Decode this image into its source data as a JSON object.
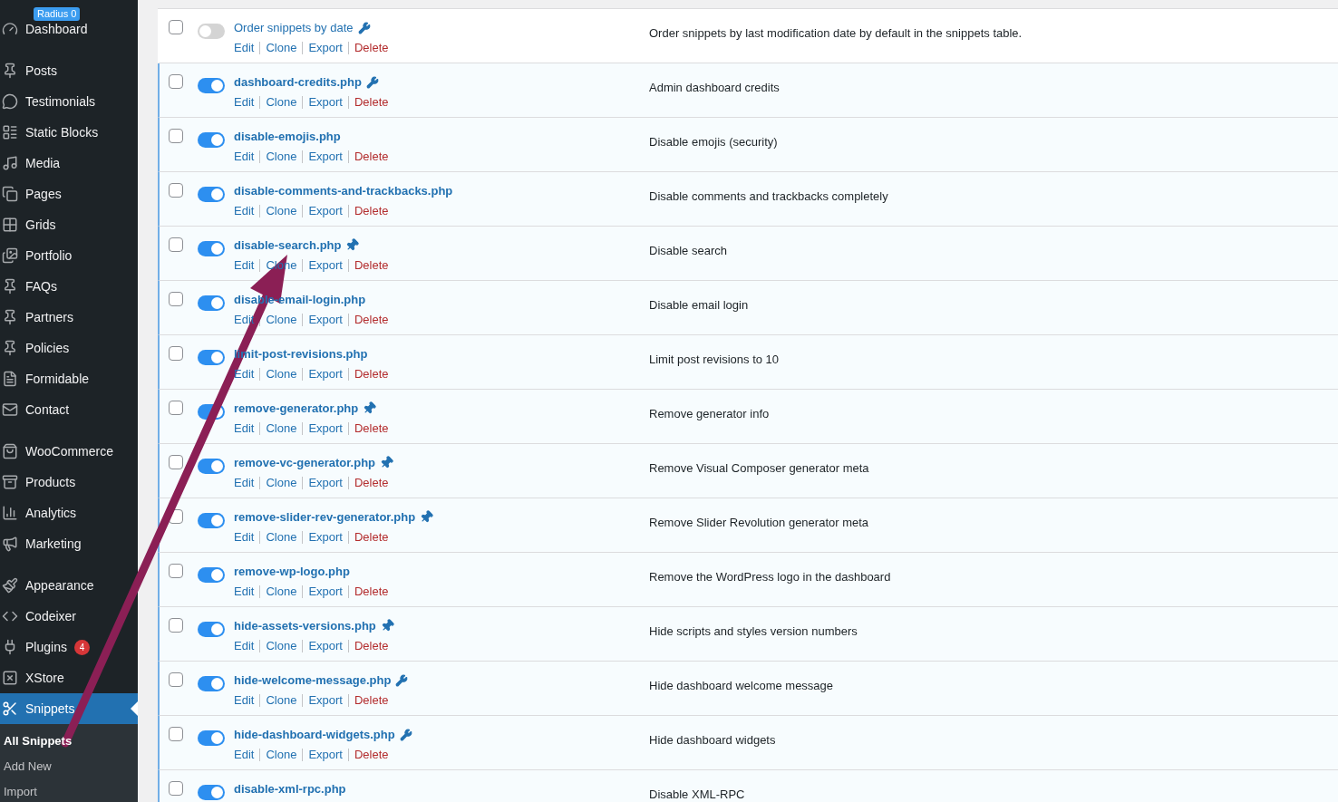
{
  "sidebar": {
    "badge": "Radius 0",
    "menu_groups": [
      {
        "items": [
          {
            "label": "Dashboard",
            "selected": false
          }
        ]
      },
      {
        "items": [
          {
            "label": "Posts",
            "selected": false
          },
          {
            "label": "Testimonials",
            "selected": false
          },
          {
            "label": "Static Blocks",
            "selected": false
          },
          {
            "label": "Media",
            "selected": false
          },
          {
            "label": "Pages",
            "selected": false
          },
          {
            "label": "Grids",
            "selected": false
          },
          {
            "label": "Portfolio",
            "selected": false
          },
          {
            "label": "FAQs",
            "selected": false
          },
          {
            "label": "Partners",
            "selected": false
          },
          {
            "label": "Policies",
            "selected": false
          },
          {
            "label": "Formidable",
            "selected": false
          },
          {
            "label": "Contact",
            "selected": false
          }
        ]
      },
      {
        "items": [
          {
            "label": "WooCommerce",
            "selected": false
          },
          {
            "label": "Products",
            "selected": false
          },
          {
            "label": "Analytics",
            "selected": false
          },
          {
            "label": "Marketing",
            "selected": false
          }
        ]
      },
      {
        "items": [
          {
            "label": "Appearance",
            "selected": false
          },
          {
            "label": "Codeixer",
            "selected": false
          },
          {
            "label": "Plugins",
            "selected": false,
            "count": "4"
          },
          {
            "label": "XStore",
            "selected": false
          },
          {
            "label": "Snippets",
            "selected": true
          }
        ]
      }
    ],
    "submenu": [
      {
        "label": "All Snippets",
        "selected": true
      },
      {
        "label": "Add New",
        "selected": false
      },
      {
        "label": "Import",
        "selected": false
      }
    ]
  },
  "snippets": [
    {
      "name": "Order snippets by date",
      "kind": "wrench",
      "active": false,
      "checked": false,
      "description": "Order snippets by last modification date by default in the snippets table.",
      "actions": [
        {
          "label": "Edit",
          "kind": "link"
        },
        {
          "label": "Clone",
          "kind": "link"
        },
        {
          "label": "Export",
          "kind": "link"
        },
        {
          "label": "Delete",
          "kind": "delete"
        }
      ]
    },
    {
      "name": "dashboard-credits.php",
      "kind": "wrench",
      "active": true,
      "checked": false,
      "description": "Admin dashboard credits",
      "actions": [
        {
          "label": "Edit",
          "kind": "link"
        },
        {
          "label": "Clone",
          "kind": "link"
        },
        {
          "label": "Export",
          "kind": "link"
        },
        {
          "label": "Delete",
          "kind": "delete"
        }
      ]
    },
    {
      "name": "disable-emojis.php",
      "kind": "plain",
      "active": true,
      "checked": false,
      "description": "Disable emojis (security)",
      "actions": [
        {
          "label": "Edit",
          "kind": "link"
        },
        {
          "label": "Clone",
          "kind": "link"
        },
        {
          "label": "Export",
          "kind": "link"
        },
        {
          "label": "Delete",
          "kind": "delete"
        }
      ]
    },
    {
      "name": "disable-comments-and-trackbacks.php",
      "kind": "plain",
      "active": true,
      "checked": false,
      "description": "Disable comments and trackbacks completely",
      "actions": [
        {
          "label": "Edit",
          "kind": "link"
        },
        {
          "label": "Clone",
          "kind": "link"
        },
        {
          "label": "Export",
          "kind": "link"
        },
        {
          "label": "Delete",
          "kind": "delete"
        }
      ]
    },
    {
      "name": "disable-search.php",
      "kind": "pin",
      "active": true,
      "checked": false,
      "description": "Disable search",
      "actions": [
        {
          "label": "Edit",
          "kind": "link"
        },
        {
          "label": "Clone",
          "kind": "link"
        },
        {
          "label": "Export",
          "kind": "link"
        },
        {
          "label": "Delete",
          "kind": "delete"
        }
      ]
    },
    {
      "name": "disable-email-login.php",
      "kind": "plain",
      "active": true,
      "checked": false,
      "description": "Disable email login",
      "actions": [
        {
          "label": "Edit",
          "kind": "link"
        },
        {
          "label": "Clone",
          "kind": "link"
        },
        {
          "label": "Export",
          "kind": "link"
        },
        {
          "label": "Delete",
          "kind": "delete"
        }
      ]
    },
    {
      "name": "limit-post-revisions.php",
      "kind": "plain",
      "active": true,
      "checked": false,
      "description": "Limit post revisions to 10",
      "actions": [
        {
          "label": "Edit",
          "kind": "link"
        },
        {
          "label": "Clone",
          "kind": "link"
        },
        {
          "label": "Export",
          "kind": "link"
        },
        {
          "label": "Delete",
          "kind": "delete"
        }
      ]
    },
    {
      "name": "remove-generator.php",
      "kind": "pin",
      "active": true,
      "checked": false,
      "description": "Remove generator info",
      "actions": [
        {
          "label": "Edit",
          "kind": "link"
        },
        {
          "label": "Clone",
          "kind": "link"
        },
        {
          "label": "Export",
          "kind": "link"
        },
        {
          "label": "Delete",
          "kind": "delete"
        }
      ]
    },
    {
      "name": "remove-vc-generator.php",
      "kind": "pin",
      "active": true,
      "checked": false,
      "description": "Remove Visual Composer generator meta",
      "actions": [
        {
          "label": "Edit",
          "kind": "link"
        },
        {
          "label": "Clone",
          "kind": "link"
        },
        {
          "label": "Export",
          "kind": "link"
        },
        {
          "label": "Delete",
          "kind": "delete"
        }
      ]
    },
    {
      "name": "remove-slider-rev-generator.php",
      "kind": "pin",
      "active": true,
      "checked": false,
      "description": "Remove Slider Revolution generator meta",
      "actions": [
        {
          "label": "Edit",
          "kind": "link"
        },
        {
          "label": "Clone",
          "kind": "link"
        },
        {
          "label": "Export",
          "kind": "link"
        },
        {
          "label": "Delete",
          "kind": "delete"
        }
      ]
    },
    {
      "name": "remove-wp-logo.php",
      "kind": "plain",
      "active": true,
      "checked": false,
      "description": "Remove the WordPress logo in the dashboard",
      "actions": [
        {
          "label": "Edit",
          "kind": "link"
        },
        {
          "label": "Clone",
          "kind": "link"
        },
        {
          "label": "Export",
          "kind": "link"
        },
        {
          "label": "Delete",
          "kind": "delete"
        }
      ]
    },
    {
      "name": "hide-assets-versions.php",
      "kind": "pin",
      "active": true,
      "checked": false,
      "description": "Hide scripts and styles version numbers",
      "actions": [
        {
          "label": "Edit",
          "kind": "link"
        },
        {
          "label": "Clone",
          "kind": "link"
        },
        {
          "label": "Export",
          "kind": "link"
        },
        {
          "label": "Delete",
          "kind": "delete"
        }
      ]
    },
    {
      "name": "hide-welcome-message.php",
      "kind": "wrench",
      "active": true,
      "checked": false,
      "description": "Hide dashboard welcome message",
      "actions": [
        {
          "label": "Edit",
          "kind": "link"
        },
        {
          "label": "Clone",
          "kind": "link"
        },
        {
          "label": "Export",
          "kind": "link"
        },
        {
          "label": "Delete",
          "kind": "delete"
        }
      ]
    },
    {
      "name": "hide-dashboard-widgets.php",
      "kind": "wrench",
      "active": true,
      "checked": false,
      "description": "Hide dashboard widgets",
      "actions": [
        {
          "label": "Edit",
          "kind": "link"
        },
        {
          "label": "Clone",
          "kind": "link"
        },
        {
          "label": "Export",
          "kind": "link"
        },
        {
          "label": "Delete",
          "kind": "delete"
        }
      ]
    },
    {
      "name": "disable-xml-rpc.php",
      "kind": "plain",
      "active": true,
      "checked": false,
      "description": "Disable XML-RPC"
    }
  ]
}
